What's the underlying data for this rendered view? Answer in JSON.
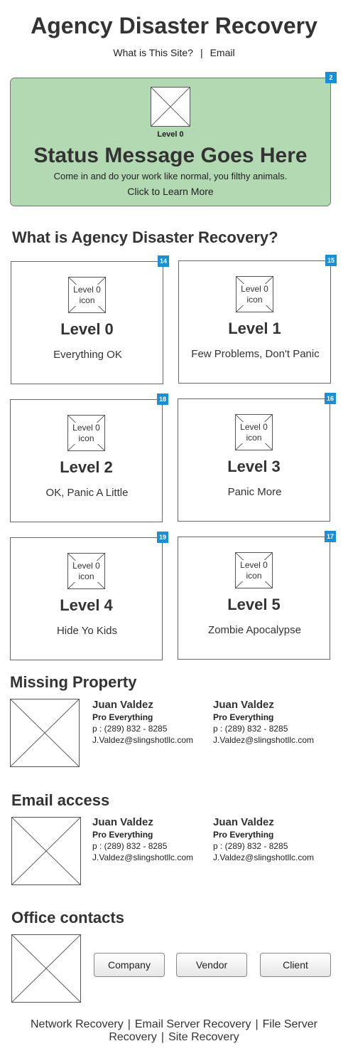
{
  "header": {
    "title": "Agency Disaster Recovery",
    "nav": {
      "about": "What is This Site?",
      "separator": "|",
      "email": "Email"
    }
  },
  "status": {
    "badge": "2",
    "level": "Level 0",
    "message": "Status Message Goes Here",
    "subtext": "Come in and do your work like normal, you filthy animals.",
    "learn_more": "Click to Learn More"
  },
  "about_section": {
    "title": "What is Agency Disaster Recovery?"
  },
  "levels": [
    {
      "badge": "14",
      "icon_label": "Level 0 icon",
      "title": "Level 0",
      "desc": "Everything OK"
    },
    {
      "badge": "15",
      "icon_label": "Level 0 icon",
      "title": "Level 1",
      "desc": "Few Problems, Don't Panic"
    },
    {
      "badge": "18",
      "icon_label": "Level 0 icon",
      "title": "Level 2",
      "desc": "OK, Panic A Little"
    },
    {
      "badge": "16",
      "icon_label": "Level 0 icon",
      "title": "Level 3",
      "desc": "Panic More"
    },
    {
      "badge": "19",
      "icon_label": "Level 0 icon",
      "title": "Level 4",
      "desc": "Hide Yo Kids"
    },
    {
      "badge": "17",
      "icon_label": "Level 0 icon",
      "title": "Level 5",
      "desc": "Zombie Apocalypse"
    }
  ],
  "missing_property": {
    "title": "Missing Property",
    "contacts": [
      {
        "name": "Juan Valdez",
        "role": "Pro Everything",
        "phone": "p : (289) 832 - 8285",
        "email": "J.Valdez@slingshotllc.com"
      },
      {
        "name": "Juan Valdez",
        "role": "Pro Everything",
        "phone": "p : (289) 832 - 8285",
        "email": "J.Valdez@slingshotllc.com"
      }
    ]
  },
  "email_access": {
    "title": "Email access",
    "contacts": [
      {
        "name": "Juan Valdez",
        "role": "Pro Everything",
        "phone": "p : (289) 832 - 8285",
        "email": "J.Valdez@slingshotllc.com"
      },
      {
        "name": "Juan Valdez",
        "role": "Pro Everything",
        "phone": "p : (289) 832 - 8285",
        "email": "J.Valdez@slingshotllc.com"
      }
    ]
  },
  "office_contacts": {
    "title": "Office contacts",
    "buttons": {
      "company": "Company",
      "vendor": "Vendor",
      "client": "Client"
    }
  },
  "footer": {
    "separator": "|",
    "links": {
      "network": "Network Recovery",
      "email_server": "Email Server Recovery",
      "file_server": "File Server Recovery",
      "site": "Site Recovery"
    }
  },
  "colors": {
    "status_bg": "#b3d9b3",
    "badge": "#1a8fd6"
  }
}
